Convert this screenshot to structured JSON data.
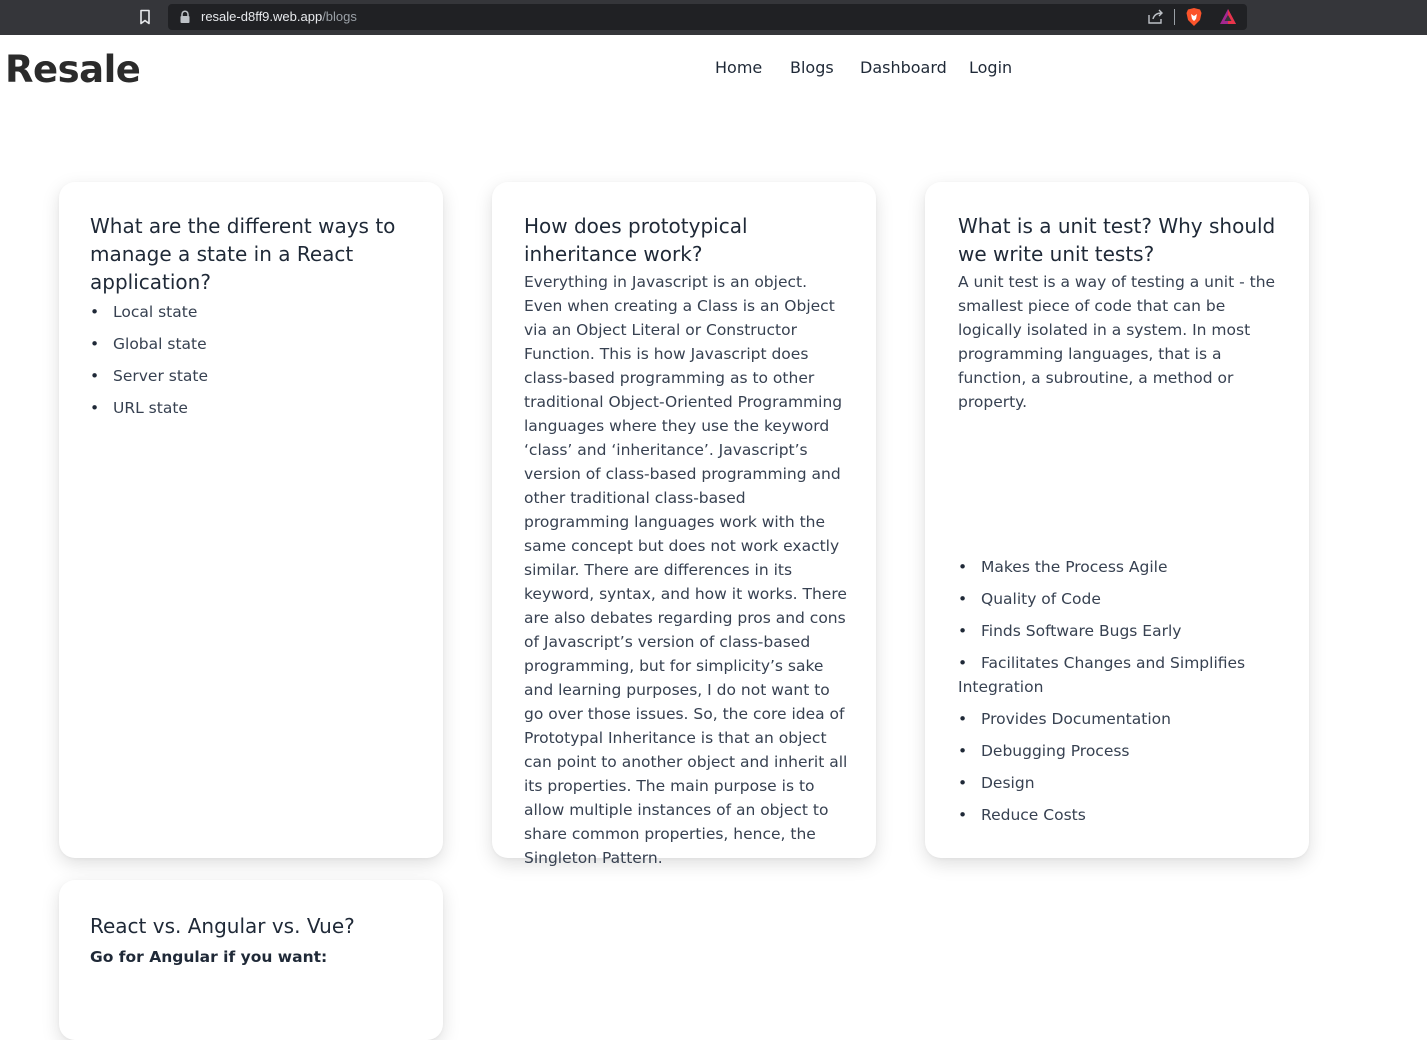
{
  "browser": {
    "url_host": "resale-d8ff9.web.app",
    "url_path": "/blogs"
  },
  "site": {
    "logo": "Resale",
    "nav": [
      {
        "label": "Home"
      },
      {
        "label": "Blogs"
      },
      {
        "label": "Dashboard"
      },
      {
        "label": "Login"
      }
    ]
  },
  "cards": [
    {
      "title": "What are the different ways to manage a state in a React application?",
      "items": [
        "Local state",
        "Global state",
        "Server state",
        "URL state"
      ]
    },
    {
      "title": "How does prototypical inheritance work?",
      "body": "Everything in Javascript is an object. Even when creating a Class is an Object via an Object Literal or Constructor Function. This is how Javascript does class-based programming as to other traditional Object-Oriented Programming languages where they use the keyword ‘class’ and ‘inheritance’. Javascript’s version of class-based programming and other traditional class-based programming languages work with the same concept but does not work exactly similar. There are differences in its keyword, syntax, and how it works. There are also debates regarding pros and cons of Javascript’s version of class-based programming, but for simplicity’s sake and learning purposes, I do not want to go over those issues. So, the core idea of Prototypal Inheritance is that an object can point to another object and inherit all its properties. The main purpose is to allow multiple instances of an object to share common properties, hence, the Singleton Pattern."
    },
    {
      "title": "What is a unit test? Why should we write unit tests?",
      "body": "A unit test is a way of testing a unit - the smallest piece of code that can be logically isolated in a system. In most programming languages, that is a function, a subroutine, a method or property.",
      "items": [
        "Makes the Process Agile",
        "Quality of Code",
        "Finds Software Bugs Early",
        "Facilitates Changes and Simplifies Integration",
        "Provides Documentation",
        "Debugging Process",
        "Design",
        "Reduce Costs"
      ]
    },
    {
      "title": "React vs. Angular vs. Vue?",
      "subhead": "Go for Angular if you want:"
    }
  ],
  "colors": {
    "chrome_bg": "#35363a",
    "omnibox_bg": "#202124",
    "brave_orange": "#fb542b"
  }
}
